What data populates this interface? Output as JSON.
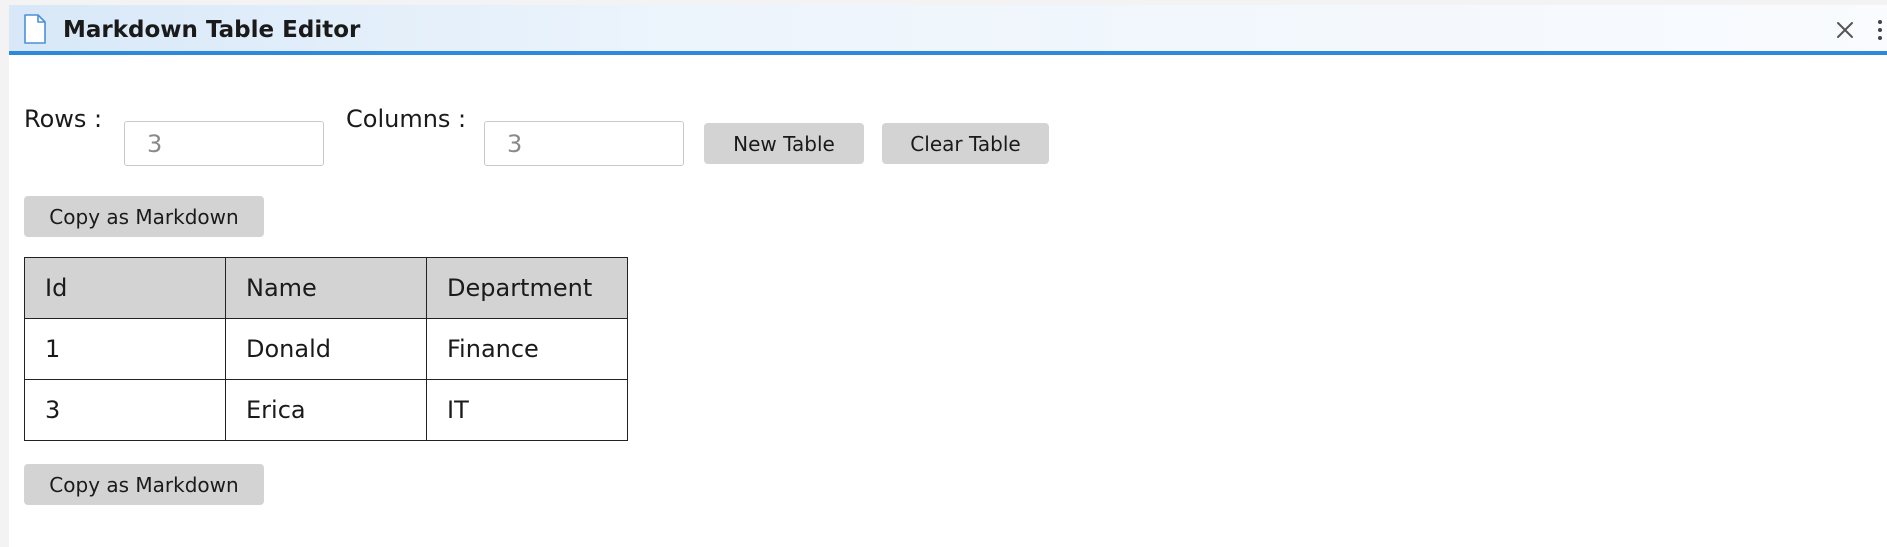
{
  "window": {
    "title": "Markdown Table Editor",
    "accent_color": "#2e8ad8"
  },
  "icons": {
    "title_icon": "document-icon",
    "close": "close-icon",
    "more": "more-vertical-icon"
  },
  "controls": {
    "rows_label": "Rows :",
    "rows_value": "",
    "rows_placeholder": "3",
    "columns_label": "Columns :",
    "columns_value": "",
    "columns_placeholder": "3",
    "new_table_label": "New Table",
    "clear_table_label": "Clear Table",
    "copy_markdown_label": "Copy as Markdown"
  },
  "table": {
    "headers": [
      "Id",
      "Name",
      "Department"
    ],
    "rows": [
      [
        "1",
        "Donald",
        "Finance"
      ],
      [
        "3",
        "Erica",
        "IT"
      ]
    ]
  }
}
